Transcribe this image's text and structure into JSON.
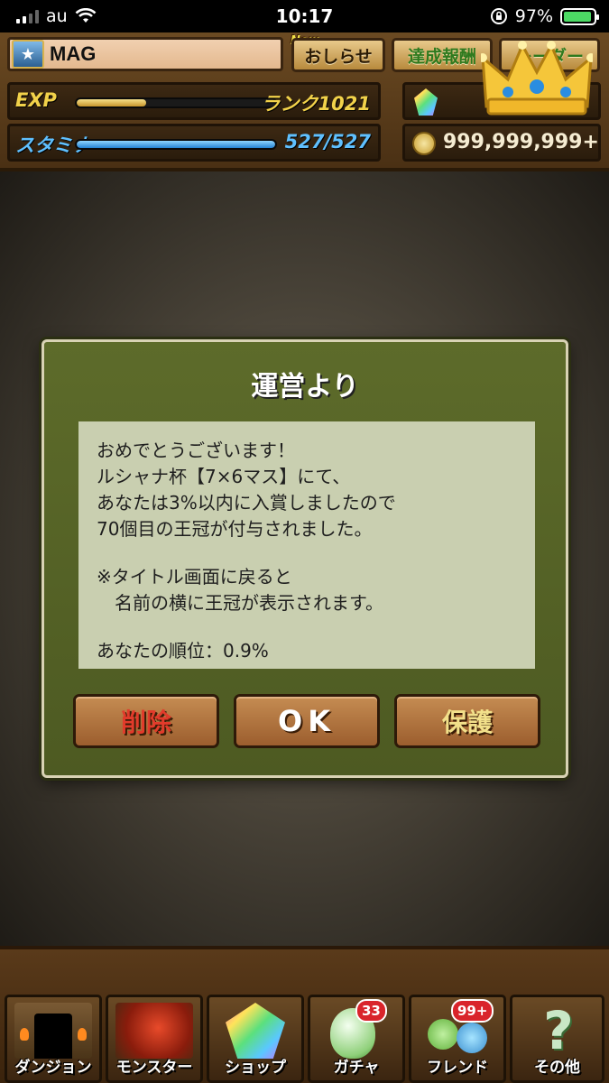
{
  "status_bar": {
    "carrier": "au",
    "time": "10:17",
    "battery": "97%"
  },
  "player": {
    "name": "MAG",
    "exp_label": "EXP",
    "exp_fill": 0.35,
    "rank": "ランク1021",
    "stamina_label": "スタミナ",
    "stamina": "527/527",
    "stamina_fill": 1.0,
    "coins": "999,999,999+"
  },
  "header_buttons": {
    "new_tag": "New",
    "notice": "おしらせ",
    "achievements": "達成報酬",
    "leader": "レーダー"
  },
  "dialog": {
    "title": "運営より",
    "lines": [
      "おめでとうございます！",
      "ルシャナ杯【7×6マス】にて、",
      "あなたは3%以内に入賞しましたので",
      "70個目の王冠が付与されました。"
    ],
    "note_lines": [
      "※タイトル画面に戻ると",
      "　名前の横に王冠が表示されます。"
    ],
    "rank_text": "あなたの順位：0.9%",
    "buttons": {
      "delete": "削除",
      "ok": "OK",
      "protect": "保護"
    }
  },
  "nav": {
    "items": [
      {
        "label": "ダンジョン"
      },
      {
        "label": "モンスター"
      },
      {
        "label": "ショップ"
      },
      {
        "label": "ガチャ",
        "badge": "33"
      },
      {
        "label": "フレンド",
        "badge": "99+"
      },
      {
        "label": "その他"
      }
    ]
  },
  "colors": {
    "exp_bar": "#e8c15a",
    "stamina_bar": "#3fa2f2",
    "dialog_green": "#56642a",
    "delete_red": "#e23b2b"
  }
}
